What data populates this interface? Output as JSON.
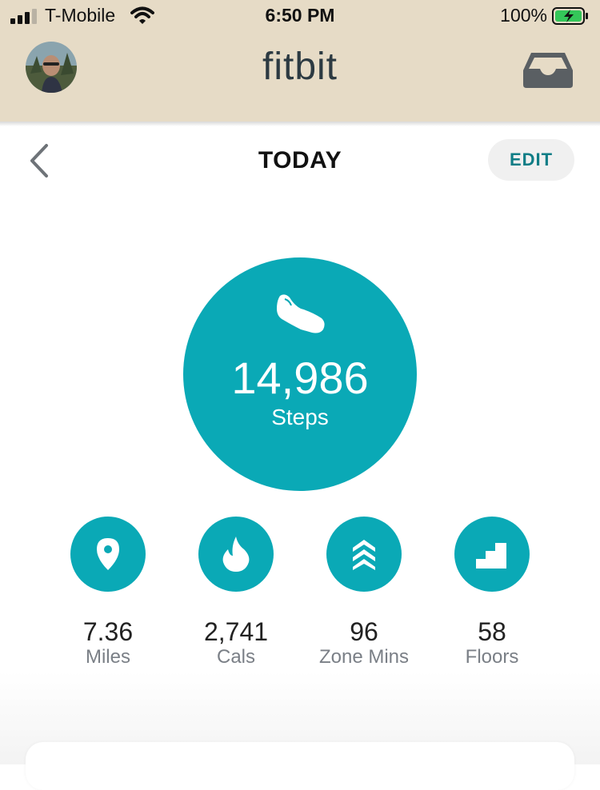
{
  "status_bar": {
    "carrier": "T-Mobile",
    "time": "6:50 PM",
    "battery": "100%"
  },
  "header": {
    "logo": "fitbit",
    "inbox_icon": "inbox-icon",
    "avatar_icon": "avatar"
  },
  "today_bar": {
    "title": "TODAY",
    "edit_label": "EDIT"
  },
  "steps": {
    "value": "14,986",
    "label": "Steps",
    "icon": "shoe-icon"
  },
  "stats": [
    {
      "icon": "location-pin-icon",
      "value": "7.36",
      "label": "Miles"
    },
    {
      "icon": "flame-icon",
      "value": "2,741",
      "label": "Cals"
    },
    {
      "icon": "chevrons-up-icon",
      "value": "96",
      "label": "Zone Mins"
    },
    {
      "icon": "stairs-icon",
      "value": "58",
      "label": "Floors"
    }
  ],
  "colors": {
    "accent": "#0aa9b6",
    "header_bg": "#e6dbc6",
    "edit_text": "#0f7d86"
  }
}
